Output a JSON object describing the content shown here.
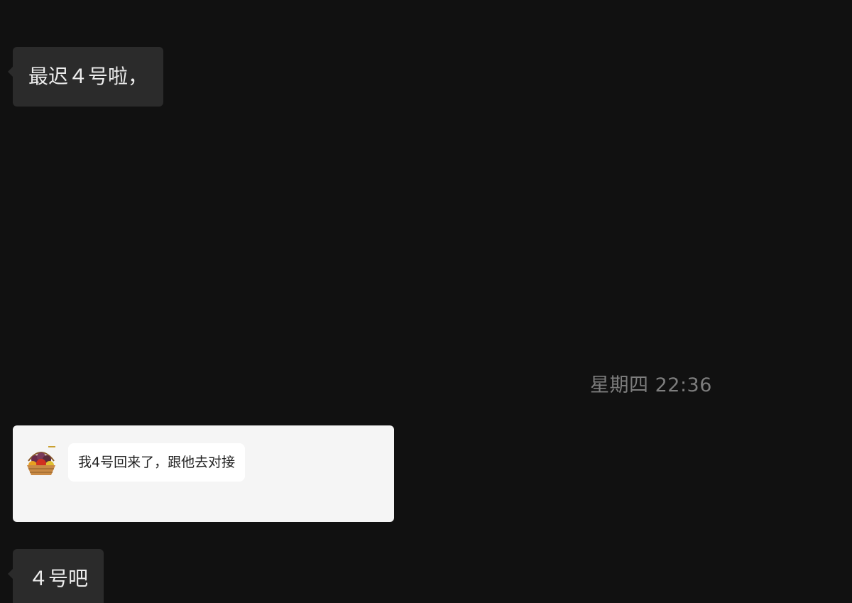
{
  "messages": [
    {
      "text": "最迟４号啦，"
    },
    {
      "text": "４号吧"
    }
  ],
  "timestamp": "星期四 22:36",
  "quoted_card": {
    "avatar_icon": "fruit-basket-icon",
    "text": "我4号回来了，跟他去对接"
  },
  "colors": {
    "background": "#111111",
    "bubble": "#2b2b2b",
    "bubble_text": "#ededed",
    "timestamp": "#7d7d7d",
    "card_bg": "#f5f5f5",
    "card_bubble": "#ffffff"
  }
}
